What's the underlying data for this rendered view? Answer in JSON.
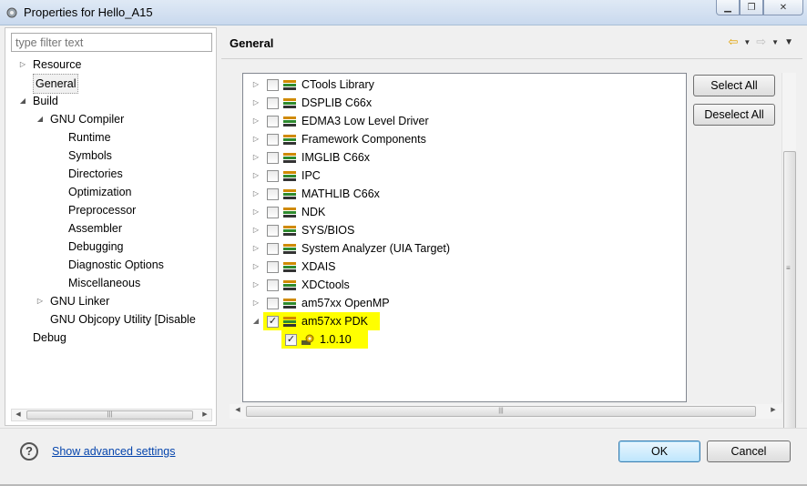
{
  "window": {
    "title": "Properties for Hello_A15",
    "buttons": [
      "minimize",
      "maximize",
      "close"
    ]
  },
  "filter": {
    "placeholder": "type filter text"
  },
  "tree": [
    {
      "label": "Resource",
      "level": 0,
      "arrow": "collapsed"
    },
    {
      "label": "General",
      "level": 0,
      "arrow": "none",
      "selected": true
    },
    {
      "label": "Build",
      "level": 0,
      "arrow": "expanded"
    },
    {
      "label": "GNU Compiler",
      "level": 1,
      "arrow": "expanded"
    },
    {
      "label": "Runtime",
      "level": 2,
      "arrow": "none"
    },
    {
      "label": "Symbols",
      "level": 2,
      "arrow": "none"
    },
    {
      "label": "Directories",
      "level": 2,
      "arrow": "none"
    },
    {
      "label": "Optimization",
      "level": 2,
      "arrow": "none"
    },
    {
      "label": "Preprocessor",
      "level": 2,
      "arrow": "none"
    },
    {
      "label": "Assembler",
      "level": 2,
      "arrow": "none"
    },
    {
      "label": "Debugging",
      "level": 2,
      "arrow": "none"
    },
    {
      "label": "Diagnostic Options",
      "level": 2,
      "arrow": "none"
    },
    {
      "label": "Miscellaneous",
      "level": 2,
      "arrow": "none"
    },
    {
      "label": "GNU Linker",
      "level": 1,
      "arrow": "collapsed"
    },
    {
      "label": "GNU Objcopy Utility  [Disable",
      "level": 1,
      "arrow": "none"
    },
    {
      "label": "Debug",
      "level": 0,
      "arrow": "none"
    }
  ],
  "main": {
    "heading": "General",
    "products": [
      {
        "label": "CTools Library",
        "checked": false,
        "expandable": true,
        "expanded": false
      },
      {
        "label": "DSPLIB C66x",
        "checked": false,
        "expandable": true,
        "expanded": false
      },
      {
        "label": "EDMA3 Low Level Driver",
        "checked": false,
        "expandable": true,
        "expanded": false
      },
      {
        "label": "Framework Components",
        "checked": false,
        "expandable": true,
        "expanded": false
      },
      {
        "label": "IMGLIB C66x",
        "checked": false,
        "expandable": true,
        "expanded": false
      },
      {
        "label": "IPC",
        "checked": false,
        "expandable": true,
        "expanded": false
      },
      {
        "label": "MATHLIB C66x",
        "checked": false,
        "expandable": true,
        "expanded": false
      },
      {
        "label": "NDK",
        "checked": false,
        "expandable": true,
        "expanded": false
      },
      {
        "label": "SYS/BIOS",
        "checked": false,
        "expandable": true,
        "expanded": false
      },
      {
        "label": "System Analyzer (UIA Target)",
        "checked": false,
        "expandable": true,
        "expanded": false
      },
      {
        "label": "XDAIS",
        "checked": false,
        "expandable": true,
        "expanded": false
      },
      {
        "label": "XDCtools",
        "checked": false,
        "expandable": true,
        "expanded": false
      },
      {
        "label": "am57xx OpenMP",
        "checked": false,
        "expandable": true,
        "expanded": false
      },
      {
        "label": "am57xx PDK",
        "checked": true,
        "expandable": true,
        "expanded": true,
        "highlighted": true
      },
      {
        "label": "1.0.10",
        "checked": true,
        "expandable": false,
        "child": true,
        "highlighted": true
      }
    ],
    "select_all": "Select All",
    "deselect_all": "Deselect All"
  },
  "footer": {
    "help": "?",
    "advanced_link": "Show advanced settings",
    "ok": "OK",
    "cancel": "Cancel"
  },
  "colors": {
    "highlight": "#ffff00",
    "link": "#0645ad",
    "ok_border": "#3c7fb1"
  }
}
